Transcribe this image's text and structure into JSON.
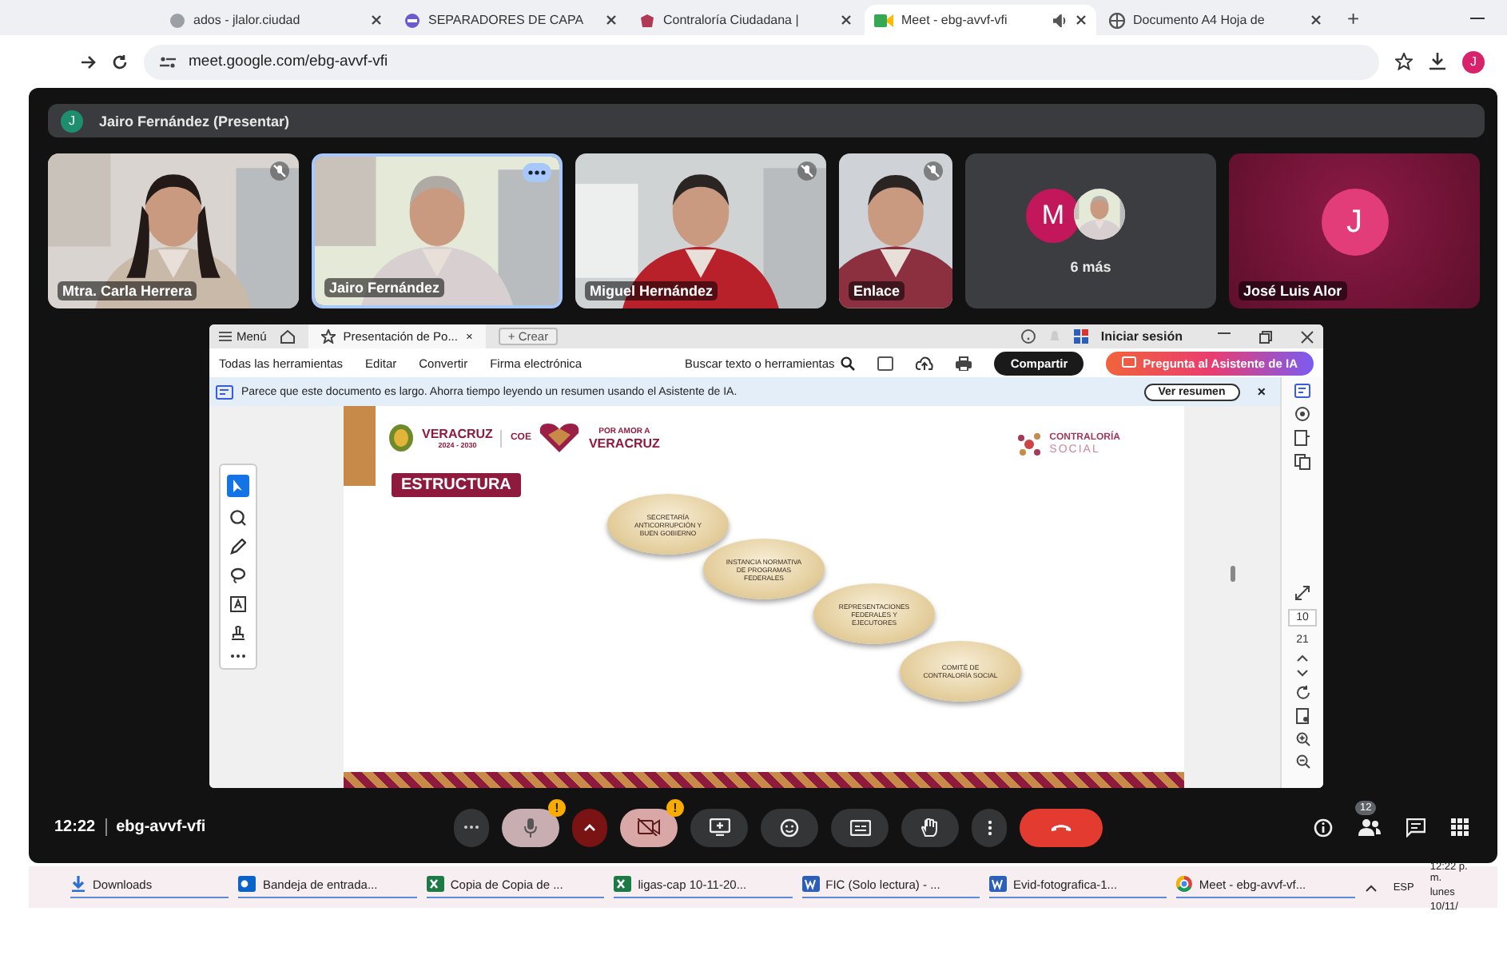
{
  "browser": {
    "tabs": [
      {
        "title": "ados - jlalor.ciudad",
        "kind": "page",
        "selected": false
      },
      {
        "title": "SEPARADORES DE CAPA",
        "kind": "slides",
        "selected": false
      },
      {
        "title": "Contraloría Ciudadana |",
        "kind": "crest",
        "selected": false
      },
      {
        "title": "Meet - ebg-avvf-vfi",
        "kind": "meet",
        "selected": true
      },
      {
        "title": "Documento A4 Hoja de",
        "kind": "globe",
        "selected": false
      }
    ],
    "new_tab": "+",
    "address": "meet.google.com/ebg-avvf-vfi",
    "profile": "J"
  },
  "meet": {
    "presenter_bar": {
      "avatar": "J",
      "label": "Jairo Fernández (Presentar)"
    },
    "participants": [
      {
        "kind": "video",
        "name": "Mtra. Carla Herrera",
        "muted": true,
        "speaking": false
      },
      {
        "kind": "video",
        "name": "Jairo Fernández",
        "muted": false,
        "speaking": true
      },
      {
        "kind": "video",
        "name": "Miguel Hernández",
        "muted": true,
        "speaking": false
      },
      {
        "kind": "video",
        "name": "Enlace",
        "muted": true,
        "speaking": false
      },
      {
        "kind": "more",
        "avatar": "M",
        "label": "6 más"
      },
      {
        "kind": "avatar",
        "avatar": "J",
        "name": "José Luis Alor"
      }
    ],
    "shared_screen": {
      "menu": "Menú",
      "tab": "Presentación de Po...",
      "tab_close": "×",
      "create": "+ Crear",
      "sign_in": "Iniciar sesión",
      "tools": [
        "Todas las herramientas",
        "Editar",
        "Convertir",
        "Firma electrónica"
      ],
      "search": "Buscar texto o herramientas",
      "share": "Compartir",
      "ai_button": "Pregunta al Asistente de IA",
      "banner": {
        "text": "Parece que este documento es largo. Ahorra tiempo leyendo un resumen usando el Asistente de IA.",
        "action": "Ver resumen",
        "close": "×"
      },
      "slide": {
        "state_name": "VERACRUZ",
        "term": "2024 - 2030",
        "org": "COE",
        "motto_top": "POR AMOR A",
        "motto": "VERACRUZ",
        "program_top": "CONTRALORÍA",
        "program": "SOCIAL",
        "title": "ESTRUCTURA",
        "steps": [
          "SECRETARÍA ANTICORRUPCIÓN Y BUEN GOBIERNO",
          "INSTANCIA NORMATIVA DE PROGRAMAS FEDERALES",
          "REPRESENTACIONES FEDERALES Y EJECUTORES",
          "COMITÉ DE CONTRALORÍA SOCIAL"
        ]
      },
      "page_current": "10",
      "page_total": "21"
    },
    "bottom_bar": {
      "time": "12:22",
      "meeting_code": "ebg-avvf-vfi",
      "mic_alert": "!",
      "camera_on": false,
      "camera_alert": "!",
      "people_count": "12"
    }
  },
  "taskbar": {
    "items": [
      {
        "kind": "download",
        "label": "Downloads"
      },
      {
        "kind": "outlook",
        "label": "Bandeja de entrada..."
      },
      {
        "kind": "excel",
        "label": "Copia de Copia de ..."
      },
      {
        "kind": "excel",
        "label": "ligas-cap 10-11-20..."
      },
      {
        "kind": "word",
        "label": "FIC (Solo lectura) - ..."
      },
      {
        "kind": "word",
        "label": "Evid-fotografica-1..."
      },
      {
        "kind": "chrome",
        "label": "Meet - ebg-avvf-vf..."
      }
    ],
    "language": "ESP",
    "time": "12:22 p. m.",
    "day": "lunes",
    "date": "10/11/"
  }
}
